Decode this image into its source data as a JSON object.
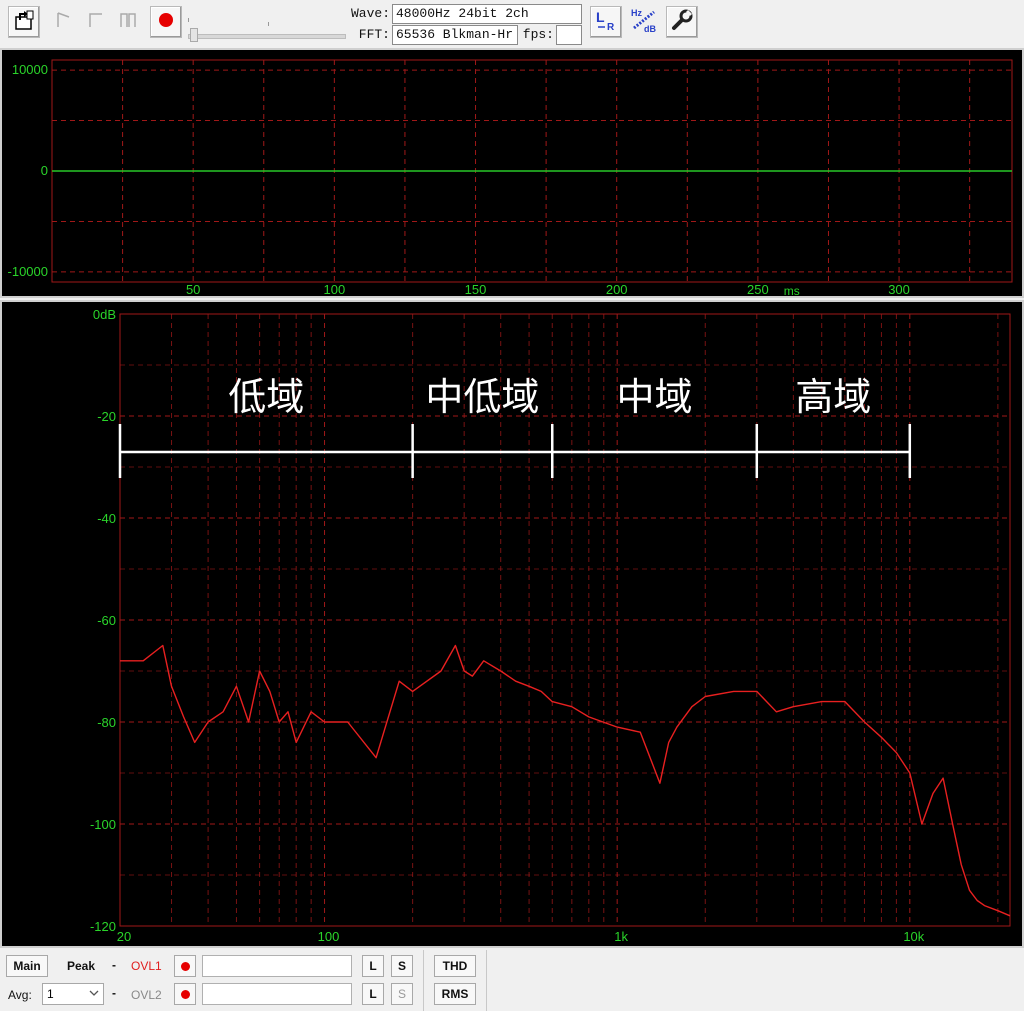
{
  "toolbar": {
    "wave_label": "Wave:",
    "wave_value": "48000Hz 24bit 2ch",
    "fft_label": "FFT:",
    "fft_value": "65536 Blkman-Hr",
    "fps_label": "fps:",
    "fps_value": "",
    "icons": [
      "open-file-icon",
      "single-trigger-icon",
      "square-icon",
      "double-step-icon",
      "record-icon",
      "lr-channel-icon",
      "hz-db-scale-icon",
      "wrench-icon"
    ]
  },
  "waveform": {
    "y_ticks": [
      {
        "label": "10000",
        "value": 10000
      },
      {
        "label": "0",
        "value": 0
      },
      {
        "label": "-10000",
        "value": -10000
      }
    ],
    "x_ticks": [
      {
        "label": "50",
        "value": 50
      },
      {
        "label": "100",
        "value": 100
      },
      {
        "label": "150",
        "value": 150
      },
      {
        "label": "200",
        "value": 200
      },
      {
        "label": "250",
        "value": 250
      },
      {
        "label": "300",
        "value": 300
      }
    ],
    "x_unit": "ms",
    "x_range": [
      0,
      340
    ],
    "y_range": [
      -11000,
      11000
    ]
  },
  "chart_data": {
    "type": "line",
    "x_scale": "log",
    "x_range": [
      20,
      22000
    ],
    "y_range": [
      -120,
      0
    ],
    "y_ticks": [
      {
        "label": "0dB",
        "value": 0
      },
      {
        "label": "-20",
        "value": -20
      },
      {
        "label": "-40",
        "value": -40
      },
      {
        "label": "-60",
        "value": -60
      },
      {
        "label": "-80",
        "value": -80
      },
      {
        "label": "-100",
        "value": -100
      },
      {
        "label": "-120",
        "value": -120
      }
    ],
    "x_ticks": [
      {
        "label": "20",
        "value": 20
      },
      {
        "label": "100",
        "value": 100
      },
      {
        "label": "1k",
        "value": 1000
      },
      {
        "label": "10k",
        "value": 10000
      }
    ],
    "series": [
      {
        "color": "#e82020",
        "x": [
          20,
          24,
          28,
          30,
          33,
          36,
          40,
          45,
          50,
          55,
          60,
          65,
          70,
          75,
          80,
          90,
          100,
          120,
          150,
          180,
          200,
          250,
          280,
          300,
          320,
          350,
          400,
          450,
          500,
          550,
          600,
          700,
          800,
          1000,
          1200,
          1400,
          1500,
          1600,
          1800,
          2000,
          2500,
          3000,
          3500,
          4000,
          5000,
          6000,
          7000,
          8000,
          9000,
          10000,
          11000,
          12000,
          13000,
          14000,
          15000,
          16000,
          17000,
          18000,
          20000,
          22000
        ],
        "y": [
          -68,
          -68,
          -65,
          -73,
          -79,
          -84,
          -80,
          -78,
          -73,
          -80,
          -70,
          -74,
          -80,
          -78,
          -84,
          -78,
          -80,
          -80,
          -87,
          -72,
          -74,
          -70,
          -65,
          -70,
          -71,
          -68,
          -70,
          -72,
          -73,
          -74,
          -76,
          -77,
          -79,
          -81,
          -82,
          -92,
          -84,
          -81,
          -77,
          -75,
          -74,
          -74,
          -78,
          -77,
          -76,
          -76,
          -80,
          -83,
          -86,
          -90,
          -100,
          -94,
          -91,
          -100,
          -108,
          -113,
          -115,
          -116,
          -117,
          -118
        ]
      }
    ],
    "annotations": {
      "bands": [
        {
          "label": "低域",
          "from": 20,
          "to": 200
        },
        {
          "label": "中低域",
          "from": 200,
          "to": 600
        },
        {
          "label": "中域",
          "from": 600,
          "to": 3000
        },
        {
          "label": "高域",
          "from": 3000,
          "to": 10000
        }
      ],
      "color": "#ffffff"
    },
    "colors": {
      "grid": "#a01818",
      "tick_text": "#2ad42a",
      "background": "#000000"
    }
  },
  "bottom": {
    "main_label": "Main",
    "peak_label": "Peak",
    "dash1": "-",
    "ovl1_label": "OVL1",
    "l_label_1": "L",
    "s_label_1": "S",
    "thd_label": "THD",
    "avg_label": "Avg:",
    "avg_value": "1",
    "dash2": "-",
    "ovl2_label": "OVL2",
    "l_label_2": "L",
    "s_label_2": "S",
    "rms_label": "RMS"
  }
}
